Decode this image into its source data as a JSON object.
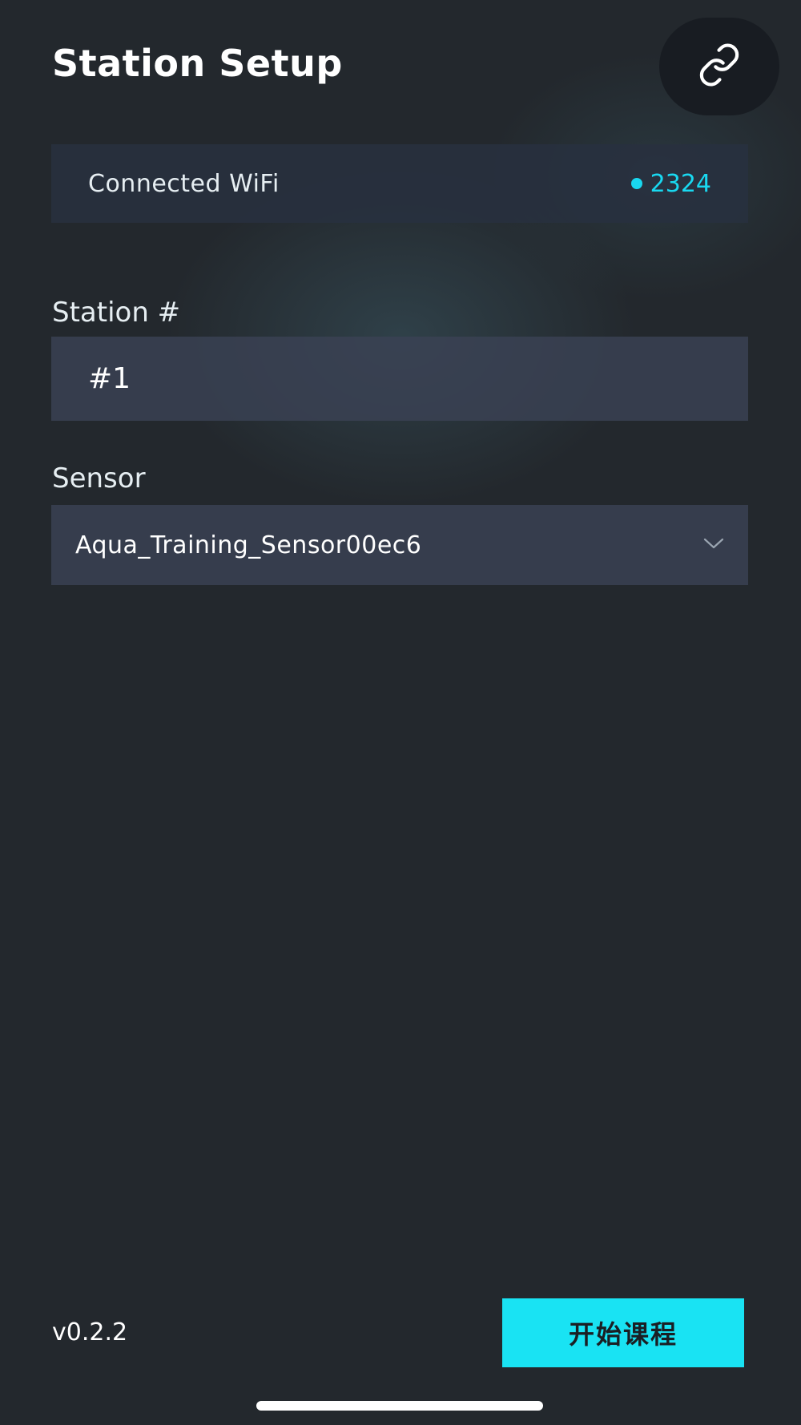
{
  "header": {
    "title": "Station Setup",
    "link_icon": "link-icon"
  },
  "wifi": {
    "label": "Connected WiFi",
    "value": "2324",
    "status_color": "#19d8f0"
  },
  "station": {
    "label": "Station #",
    "value": "#1"
  },
  "sensor": {
    "label": "Sensor",
    "selected": "Aqua_Training_Sensor00ec6",
    "dropdown_icon": "chevron-down-icon"
  },
  "footer": {
    "version": "v0.2.2",
    "start_label": "开始课程",
    "accent_color": "#19e3f3"
  }
}
